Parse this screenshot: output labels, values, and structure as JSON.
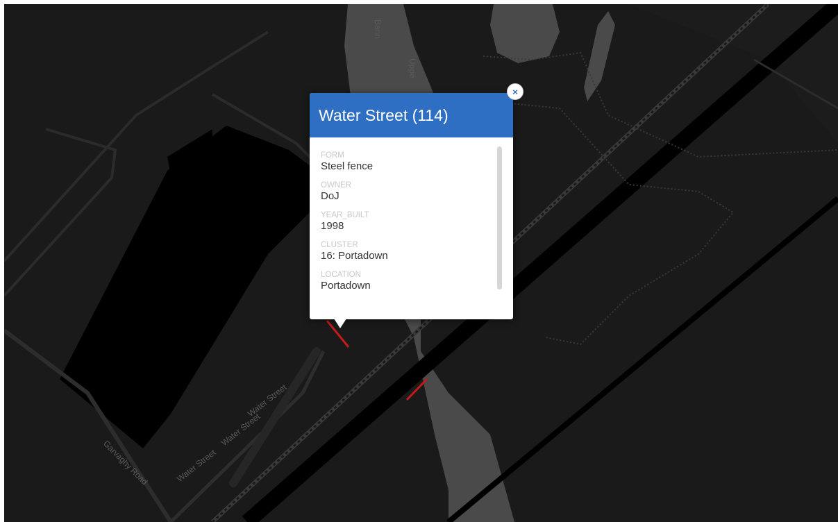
{
  "map": {
    "labels": {
      "river": "Bann",
      "river_upper": "Uppe",
      "garvaghy": "Garvaghy Road",
      "water1": "Water Street",
      "water2": "Water Street",
      "water3": "Water Street"
    },
    "colors": {
      "background": "#1a1a1a",
      "water": "#4a4a4a",
      "building": "#000000",
      "road": "#2a2a2a",
      "fence_line": "#c41a1a"
    }
  },
  "popup": {
    "title": "Water Street (114)",
    "close_label": "×",
    "fields": [
      {
        "label": "FORM",
        "value": "Steel fence"
      },
      {
        "label": "OWNER",
        "value": "DoJ"
      },
      {
        "label": "YEAR_BUILT",
        "value": "1998"
      },
      {
        "label": "CLUSTER",
        "value": "16: Portadown"
      },
      {
        "label": "LOCATION",
        "value": "Portadown"
      }
    ],
    "header_color": "#2e6fc4"
  }
}
